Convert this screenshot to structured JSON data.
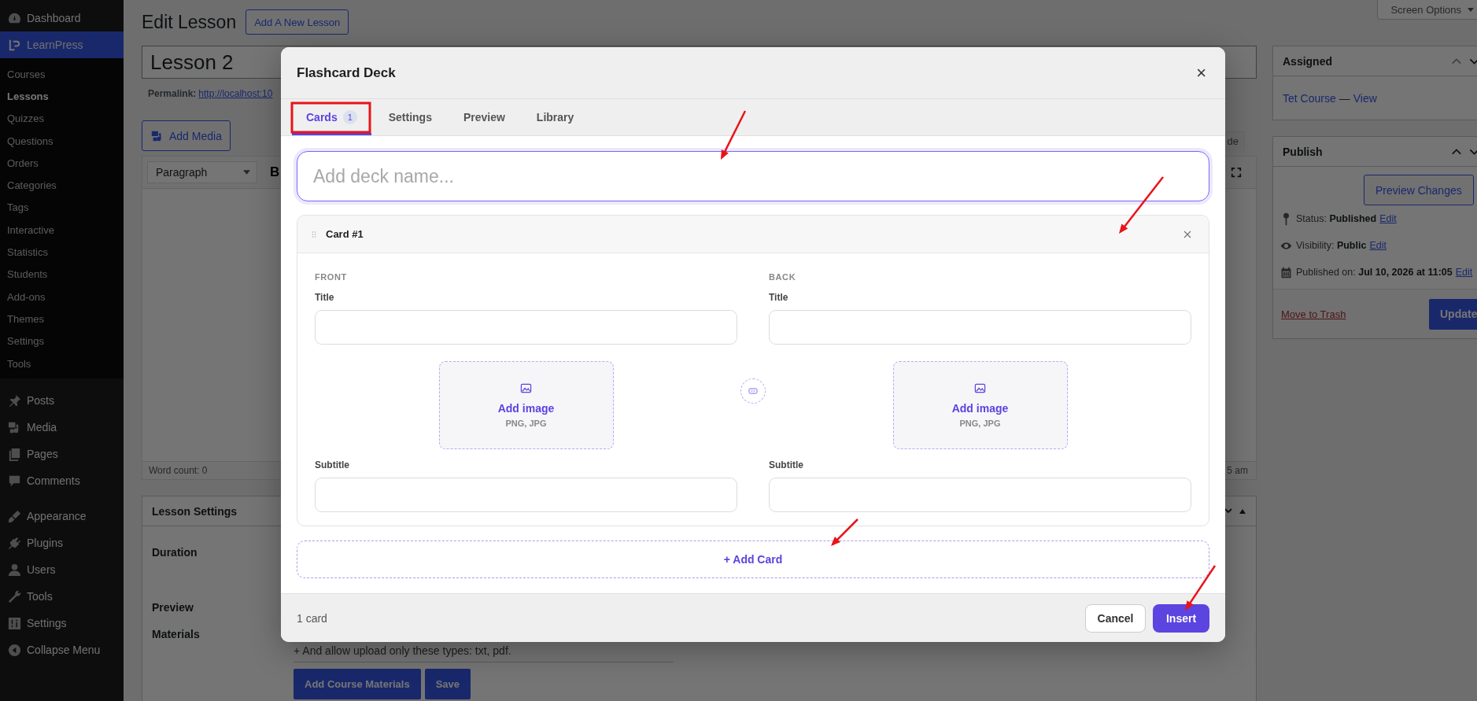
{
  "sidebar": {
    "groups": [
      [
        {
          "label": "Dashboard",
          "selected": false
        },
        {
          "label": "LearnPress",
          "selected": true,
          "children": [
            {
              "label": "Courses",
              "selected": false
            },
            {
              "label": "Lessons",
              "selected": true
            },
            {
              "label": "Quizzes",
              "selected": false
            },
            {
              "label": "Questions",
              "selected": false
            },
            {
              "label": "Orders",
              "selected": false
            },
            {
              "label": "Categories",
              "selected": false
            },
            {
              "label": "Tags",
              "selected": false
            },
            {
              "label": "Interactive",
              "selected": false
            },
            {
              "label": "Statistics",
              "selected": false
            },
            {
              "label": "Students",
              "selected": false
            },
            {
              "label": "Add-ons",
              "selected": false
            },
            {
              "label": "Themes",
              "selected": false
            },
            {
              "label": "Settings",
              "selected": false
            },
            {
              "label": "Tools",
              "selected": false
            }
          ]
        }
      ],
      [
        {
          "label": "Posts",
          "selected": false
        },
        {
          "label": "Media",
          "selected": false
        },
        {
          "label": "Pages",
          "selected": false
        },
        {
          "label": "Comments",
          "selected": false
        }
      ],
      [
        {
          "label": "Appearance",
          "selected": false
        },
        {
          "label": "Plugins",
          "selected": false
        },
        {
          "label": "Users",
          "selected": false
        },
        {
          "label": "Tools",
          "selected": false
        },
        {
          "label": "Settings",
          "selected": false
        },
        {
          "label": "Collapse Menu",
          "selected": false
        }
      ]
    ]
  },
  "page": {
    "title": "Edit Lesson",
    "add_new_button": "Add A New Lesson",
    "post_title": "Lesson 2",
    "permalink_label": "Permalink:",
    "permalink_url": "http://localhost:10",
    "add_media": "Add Media",
    "editor": {
      "format": "Paragraph",
      "bold": "B",
      "tab_fragment": "de",
      "word_count": "Word count: 0",
      "last_edited_fragment": "5 am"
    },
    "lesson_settings": {
      "title": "Lesson Settings",
      "fields": [
        "Duration",
        "Preview",
        "Materials"
      ],
      "materials_note": "+ And allow upload only these types: txt, pdf.",
      "buttons": [
        "Add Course Materials",
        "Save"
      ]
    }
  },
  "side": {
    "screen_options": "Screen Options",
    "assigned": {
      "title": "Assigned",
      "course": "Tet Course",
      "separator": "—",
      "view": "View"
    },
    "publish": {
      "title": "Publish",
      "preview_button": "Preview Changes",
      "rows": [
        {
          "label": "Status:",
          "value": "Published",
          "link": "Edit"
        },
        {
          "label": "Visibility:",
          "value": "Public",
          "link": "Edit"
        },
        {
          "label": "Published on:",
          "value": "Jul 10, 2026 at 11:05",
          "link": "Edit"
        }
      ],
      "trash": "Move to Trash",
      "update": "Update"
    }
  },
  "modal": {
    "title": "Flashcard Deck",
    "close": "×",
    "tabs": [
      {
        "label": "Cards",
        "badge": "1",
        "selected": true
      },
      {
        "label": "Settings",
        "selected": false
      },
      {
        "label": "Preview",
        "selected": false
      },
      {
        "label": "Library",
        "selected": false
      }
    ],
    "deck_name": {
      "placeholder": "Add deck name..."
    },
    "cards": [
      {
        "title": "Card #1",
        "sides": [
          {
            "heading": "FRONT",
            "title_label": "Title",
            "image_label": "Add image",
            "image_hint": "PNG, JPG",
            "subtitle_label": "Subtitle"
          },
          {
            "heading": "BACK",
            "title_label": "Title",
            "image_label": "Add image",
            "image_hint": "PNG, JPG",
            "subtitle_label": "Subtitle"
          }
        ]
      }
    ],
    "add_card": "+ Add Card",
    "count": "1 card",
    "cancel": "Cancel",
    "insert": "Insert"
  }
}
